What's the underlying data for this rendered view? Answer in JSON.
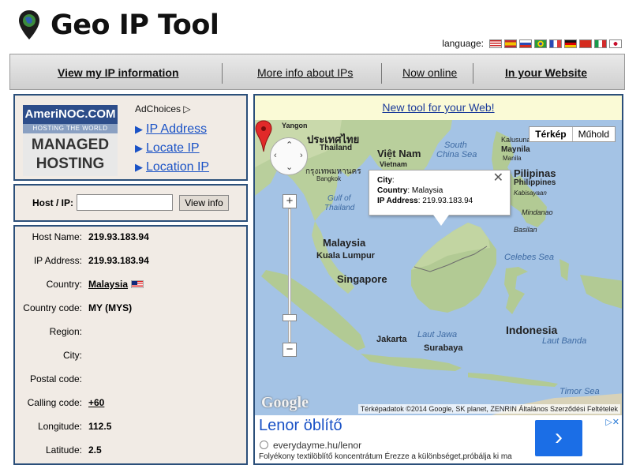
{
  "site": {
    "title": "Geo IP Tool"
  },
  "language": {
    "label": "language:",
    "flags": [
      "flag-english-icon",
      "flag-spanish-icon",
      "flag-russian-icon",
      "flag-portuguese-icon",
      "flag-french-icon",
      "flag-german-icon",
      "flag-chinese-icon",
      "flag-italian-icon",
      "flag-japanese-icon"
    ]
  },
  "nav": {
    "items": [
      {
        "label": "View my IP information"
      },
      {
        "label": "More info about IPs"
      },
      {
        "label": "Now online"
      },
      {
        "label": "In your Website"
      }
    ]
  },
  "ad_box": {
    "logo_line1": "AmeriNOC.COM",
    "logo_line2": "HOSTING THE WORLD",
    "logo_line3": "MANAGED",
    "logo_line4": "HOSTING",
    "adchoices": "AdChoices",
    "links": [
      "IP Address",
      "Locate IP",
      "Location IP"
    ]
  },
  "lookup": {
    "label": "Host / IP:",
    "input_value": "",
    "button": "View info"
  },
  "info": {
    "rows": [
      {
        "label": "Host Name:",
        "value": "219.93.183.94"
      },
      {
        "label": "IP Address:",
        "value": "219.93.183.94"
      },
      {
        "label": "Country:",
        "value": "Malaysia"
      },
      {
        "label": "Country code:",
        "value": "MY (MYS)"
      },
      {
        "label": "Region:",
        "value": ""
      },
      {
        "label": "City:",
        "value": ""
      },
      {
        "label": "Postal code:",
        "value": ""
      },
      {
        "label": "Calling code:",
        "value": "+60"
      },
      {
        "label": "Longitude:",
        "value": "112.5"
      },
      {
        "label": "Latitude:",
        "value": "2.5"
      }
    ]
  },
  "newtool": {
    "label": "New tool for your Web!"
  },
  "map": {
    "type_map": "Térkép",
    "type_sat": "Műhold",
    "popup": {
      "city_label": "City",
      "city_value": ":",
      "country_label": "Country",
      "country_value": ": Malaysia",
      "ip_label": "IP Address",
      "ip_value": ": 219.93.183.94"
    },
    "labels": {
      "yangon": "Yangon",
      "thailand_th": "ประเทศไทย",
      "thailand": "Thailand",
      "bangkok_th": "กรุงเทพมหานคร",
      "bangkok": "Bangkok",
      "vietnam_vn": "Việt Nam",
      "vietnam": "Vietnam",
      "south_china_sea": "South",
      "south_china_sea2": "China Sea",
      "kalusunan": "Kalusunan",
      "maynila": "Maynila",
      "manila": "Manila",
      "pilipinas": "Pilipinas",
      "philippines": "Philippines",
      "kabisayaan": "Kabisayaan",
      "mindanao": "Mindanao",
      "basilan": "Basilan",
      "gulf1": "Gulf of",
      "gulf2": "Thailand",
      "malaysia": "Malaysia",
      "kuala_lumpur": "Kuala Lumpur",
      "singapore": "Singapore",
      "celebes": "Celebes Sea",
      "indonesia": "Indonesia",
      "java_sea": "Laut Jawa",
      "jakarta": "Jakarta",
      "surabaya": "Surabaya",
      "laut_banda": "Laut Banda",
      "timor_sea": "Timor Sea"
    },
    "google": "Google",
    "footer": "Térképadatok ©2014 Google, SK planet, ZENRIN   Általános Szerződési Feltételek",
    "colors": {
      "water": "#a4c3e5",
      "land": "#e8e4d3",
      "green": "#b7cf9a"
    }
  },
  "ad_bottom": {
    "title": "Lenor öblítő",
    "url": "everydayme.hu/lenor",
    "desc": "Folyékony textilöblítő koncentrátum Érezze a különbséget,próbálja ki ma",
    "arrow": "›"
  }
}
